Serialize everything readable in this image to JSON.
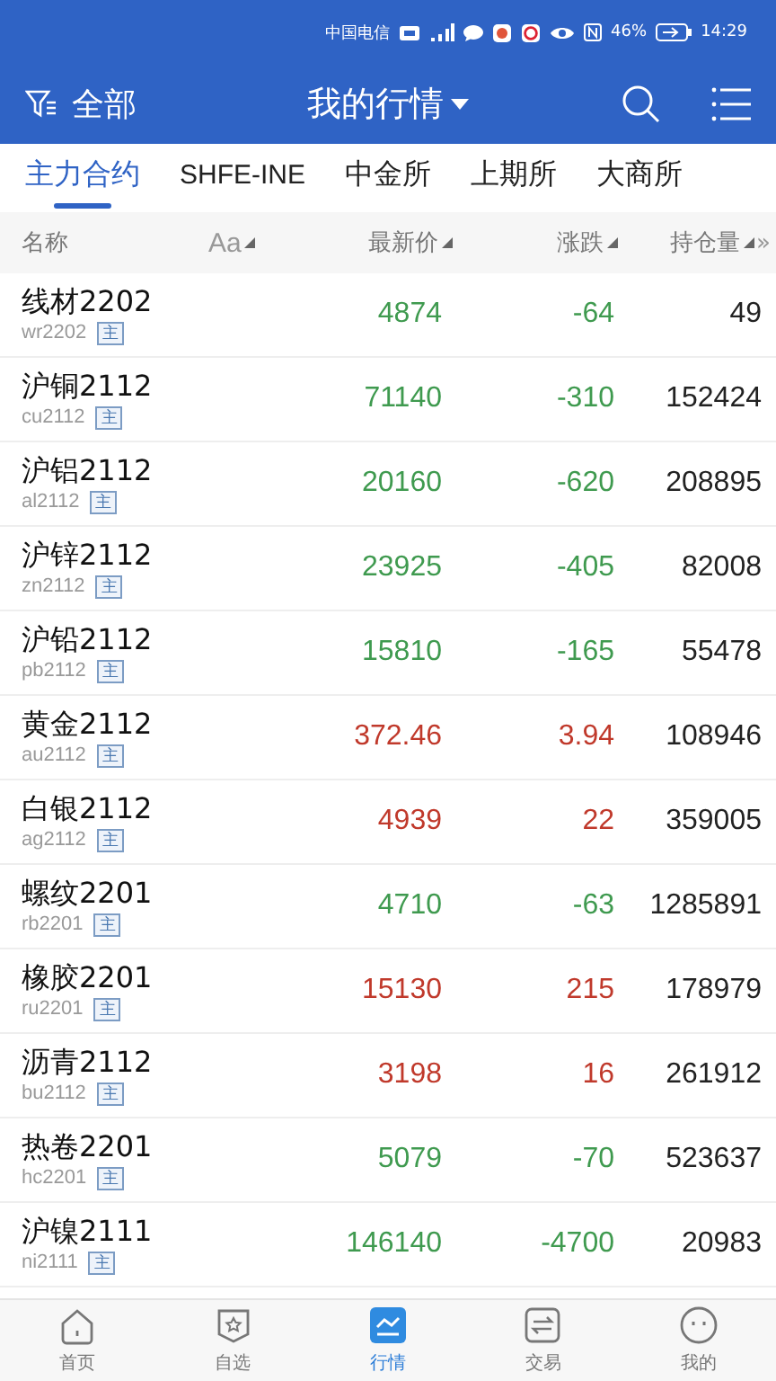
{
  "status_bar": {
    "carrier": "中国电信",
    "battery": "46%",
    "time": "14:29"
  },
  "header": {
    "filter_label": "全部",
    "title": "我的行情"
  },
  "tabs": [
    {
      "label": "主力合约",
      "selected": true
    },
    {
      "label": "SHFE-INE",
      "selected": false
    },
    {
      "label": "中金所",
      "selected": false
    },
    {
      "label": "上期所",
      "selected": false
    },
    {
      "label": "大商所",
      "selected": false
    }
  ],
  "columns": {
    "name": "名称",
    "font_toggle": "Aa",
    "price": "最新价",
    "change": "涨跌",
    "open_interest": "持仓量",
    "more": "»"
  },
  "rows": [
    {
      "name": "线材2202",
      "code": "wr2202",
      "badge": "主",
      "price": "4874",
      "change": "-64",
      "open_interest": "49",
      "color": "#3f9a4f"
    },
    {
      "name": "沪铜2112",
      "code": "cu2112",
      "badge": "主",
      "price": "71140",
      "change": "-310",
      "open_interest": "152424",
      "color": "#3f9a4f"
    },
    {
      "name": "沪铝2112",
      "code": "al2112",
      "badge": "主",
      "price": "20160",
      "change": "-620",
      "open_interest": "208895",
      "color": "#3f9a4f"
    },
    {
      "name": "沪锌2112",
      "code": "zn2112",
      "badge": "主",
      "price": "23925",
      "change": "-405",
      "open_interest": "82008",
      "color": "#3f9a4f"
    },
    {
      "name": "沪铅2112",
      "code": "pb2112",
      "badge": "主",
      "price": "15810",
      "change": "-165",
      "open_interest": "55478",
      "color": "#3f9a4f"
    },
    {
      "name": "黄金2112",
      "code": "au2112",
      "badge": "主",
      "price": "372.46",
      "change": "3.94",
      "open_interest": "108946",
      "color": "#c0392b"
    },
    {
      "name": "白银2112",
      "code": "ag2112",
      "badge": "主",
      "price": "4939",
      "change": "22",
      "open_interest": "359005",
      "color": "#c0392b"
    },
    {
      "name": "螺纹2201",
      "code": "rb2201",
      "badge": "主",
      "price": "4710",
      "change": "-63",
      "open_interest": "1285891",
      "color": "#3f9a4f"
    },
    {
      "name": "橡胶2201",
      "code": "ru2201",
      "badge": "主",
      "price": "15130",
      "change": "215",
      "open_interest": "178979",
      "color": "#c0392b"
    },
    {
      "name": "沥青2112",
      "code": "bu2112",
      "badge": "主",
      "price": "3198",
      "change": "16",
      "open_interest": "261912",
      "color": "#c0392b"
    },
    {
      "name": "热卷2201",
      "code": "hc2201",
      "badge": "主",
      "price": "5079",
      "change": "-70",
      "open_interest": "523637",
      "color": "#3f9a4f"
    },
    {
      "name": "沪镍2111",
      "code": "ni2111",
      "badge": "主",
      "price": "146140",
      "change": "-4700",
      "open_interest": "20983",
      "color": "#3f9a4f"
    }
  ],
  "nav": [
    {
      "label": "首页",
      "kind": "home",
      "selected": false
    },
    {
      "label": "自选",
      "kind": "star",
      "selected": false
    },
    {
      "label": "行情",
      "kind": "chart",
      "selected": true
    },
    {
      "label": "交易",
      "kind": "swap",
      "selected": false
    },
    {
      "label": "我的",
      "kind": "face",
      "selected": false
    }
  ]
}
